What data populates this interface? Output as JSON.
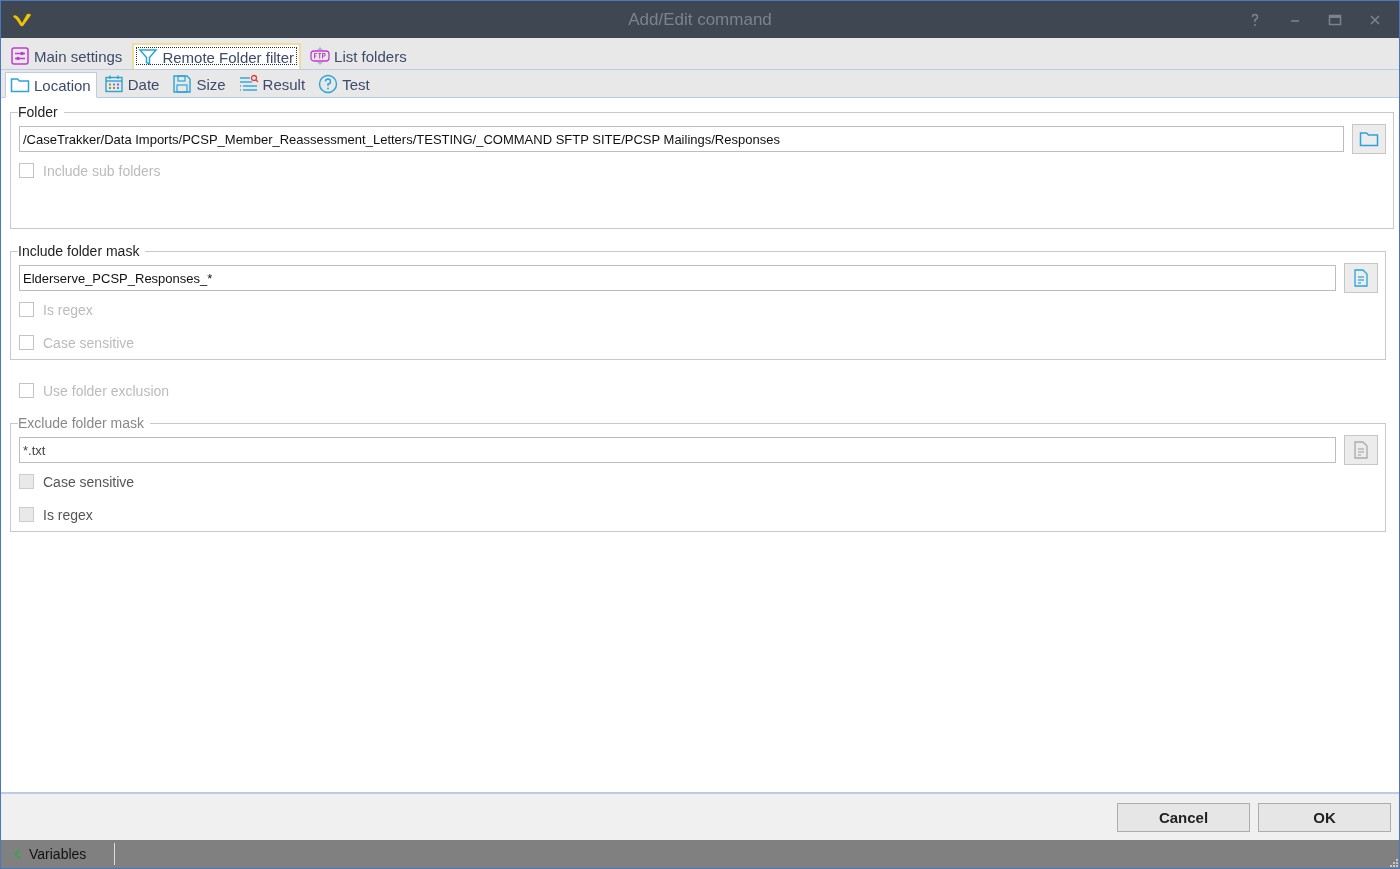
{
  "window": {
    "title": "Add/Edit command"
  },
  "tabs": [
    {
      "label": "Main settings",
      "selected": false
    },
    {
      "label": "Remote Folder filter",
      "selected": true
    },
    {
      "label": "List folders",
      "selected": false
    }
  ],
  "subtabs": [
    {
      "label": "Location",
      "selected": true
    },
    {
      "label": "Date",
      "selected": false
    },
    {
      "label": "Size",
      "selected": false
    },
    {
      "label": "Result",
      "selected": false
    },
    {
      "label": "Test",
      "selected": false
    }
  ],
  "sections": [
    {
      "kind": "group",
      "title": "Folder",
      "value": "/CaseTrakker/Data Imports/PCSP_Member_Reassessment_Letters/TESTING/_COMMAND SFTP SITE/PCSP Mailings/Responses",
      "disabled": false,
      "checkboxes": [
        {
          "label": "Include sub folders",
          "checked": false,
          "disabled": true
        }
      ]
    },
    {
      "kind": "group",
      "title": "Include folder mask",
      "value": "Elderserve_PCSP_Responses_*",
      "disabled": false,
      "checkboxes": [
        {
          "label": "Is regex",
          "checked": false,
          "disabled": true
        },
        {
          "label": "Case sensitive",
          "checked": false,
          "disabled": true
        }
      ]
    },
    {
      "kind": "checkbox",
      "label": "Use folder exclusion",
      "checked": false,
      "disabled": true
    },
    {
      "kind": "group",
      "title": "Exclude folder mask",
      "value": "*.txt",
      "disabled": true,
      "checkboxes": [
        {
          "label": "Case sensitive",
          "checked": false,
          "disabled": false
        },
        {
          "label": "Is regex",
          "checked": false,
          "disabled": false
        }
      ]
    }
  ],
  "buttons": [
    "Cancel",
    "OK"
  ],
  "status_bar": {
    "label": "Variables"
  }
}
